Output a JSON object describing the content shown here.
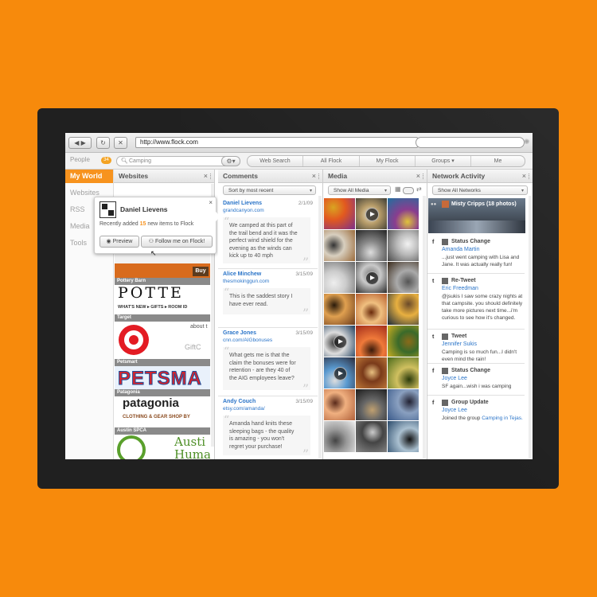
{
  "browser": {
    "back_label": "◀ ▶",
    "reload_icon": "reload-icon",
    "stop_icon": "stop-icon",
    "url": "http://www.flock.com",
    "search_value": ""
  },
  "toolbar": {
    "people_label": "People",
    "people_count": "34",
    "search_value": "Camping",
    "segments": [
      "Web Search",
      "All Flock",
      "My Flock",
      "Groups",
      "Me"
    ]
  },
  "sidebar": {
    "items": [
      {
        "label": "My World",
        "active": true
      },
      {
        "label": "Websites"
      },
      {
        "label": "RSS"
      },
      {
        "label": "Media"
      },
      {
        "label": "Tools"
      }
    ]
  },
  "websites": {
    "title": "Websites",
    "close": "×",
    "popup": {
      "name": "Daniel Lievens",
      "line_prefix": "Recently added ",
      "count": "15",
      "line_suffix": " new items to Flock",
      "preview_label": "Preview",
      "follow_label": "Follow me on Flock!",
      "close": "×"
    },
    "sites": [
      {
        "label": "Pottery Barn",
        "text": "POTTE",
        "sub": "WHAT'S NEW ▸  GIFTS ▸  ROOM ID",
        "btn": "Buy"
      },
      {
        "label": "Target",
        "text": "about t",
        "sub": "GiftC"
      },
      {
        "label": "Petsmart",
        "text": "PETSMA"
      },
      {
        "label": "Patagonia",
        "text": "patagonia",
        "sub": "CLOTHING & GEAR    SHOP BY"
      },
      {
        "label": "Austin SPCA",
        "text": "Austi",
        "sub": "Huma"
      }
    ]
  },
  "comments": {
    "title": "Comments",
    "close": "×",
    "sort_label": "Sort by most recent",
    "items": [
      {
        "name": "Daniel Lievens",
        "date": "2/1/09",
        "url": "grandcanyon.com",
        "text": "We camped at this part of the trail bend and it was the perfect wind shield for the evening as the winds can kick up to 40 mph"
      },
      {
        "name": "Alice Minchew",
        "date": "3/15/09",
        "url": "thesmokinggun.com",
        "text": "This is the saddest story I have ever read."
      },
      {
        "name": "Grace Jones",
        "date": "3/15/09",
        "url": "cnn.com/AIGbonuses",
        "text": "What gets me is that the claim the bonuses were for retention - are they 40 of the AIG employees leave?"
      },
      {
        "name": "Andy Couch",
        "date": "3/15/09",
        "url": "etsy.com/amanda/",
        "text": "Amanda hand knits these sleeping bags - the quality is amazing - you won't regret your purchase!"
      }
    ]
  },
  "media": {
    "title": "Media",
    "close": "×",
    "filter_label": "Show All Media"
  },
  "network": {
    "title": "Network Activity",
    "close": "×",
    "filter_label": "Show All Networks",
    "banner": "Misty Cripps (18 photos)",
    "items": [
      {
        "service": "f",
        "type": "Status Change",
        "user": "Amanda Martin",
        "text": "...just went camping with Lisa and Jane. It was actually really fun!"
      },
      {
        "service": "t",
        "type": "Re-Tweet",
        "user": "Eric Freedman",
        "text": "@jsukis I saw some crazy nights at that campsite. you should definitely take more pictures next time...i'm curious to see how it's changed."
      },
      {
        "service": "t",
        "type": "Tweet",
        "user": "Jennifer Sukis",
        "text": "Camping is so much fun...I didn't even mind the rain!"
      },
      {
        "service": "f",
        "type": "Status Change",
        "user": "Joyce Lee",
        "text": "SF again...wish i was camping"
      },
      {
        "service": "f",
        "type": "Group Update",
        "user": "Joyce Lee",
        "text_prefix": "Joined the group ",
        "text_link": "Camping in Tejas."
      }
    ]
  },
  "colors": {
    "accent": "#f7931e",
    "background": "#f78a0c",
    "link": "#2a74c8"
  }
}
